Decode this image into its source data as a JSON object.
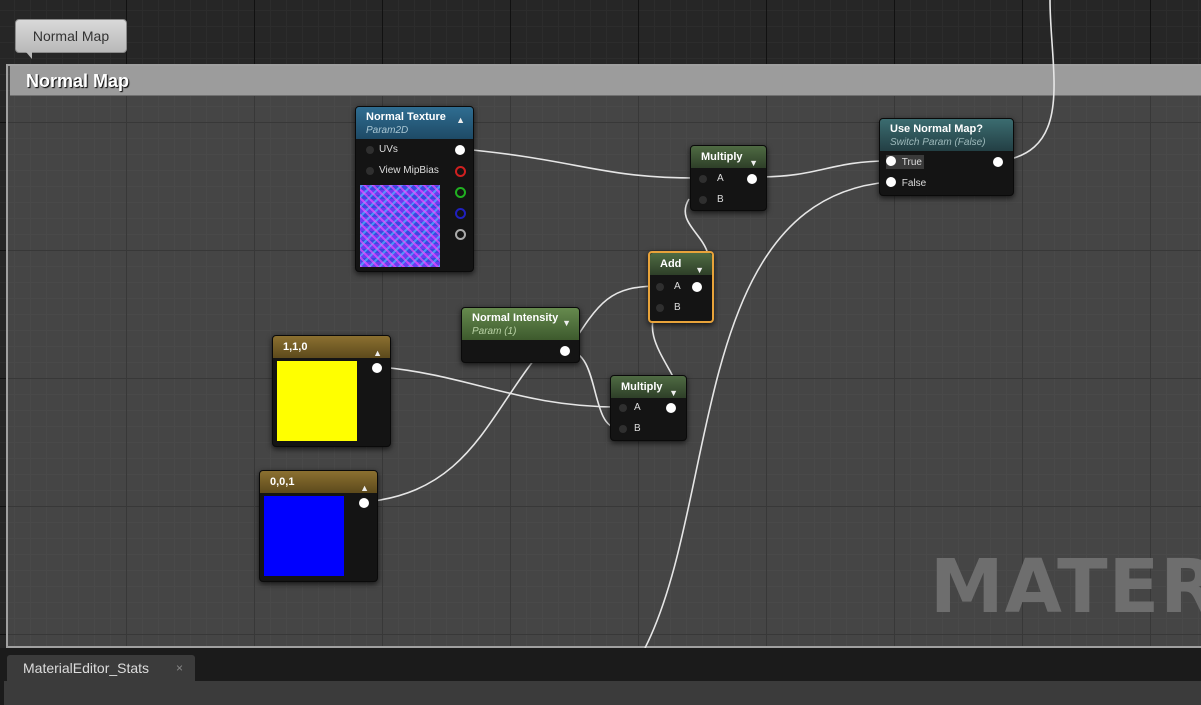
{
  "comment": {
    "bubble": "Normal Map",
    "title": "Normal Map"
  },
  "nodes": {
    "normal_texture": {
      "title": "Normal Texture",
      "sub": "Param2D",
      "pins": [
        "UVs",
        "View MipBias"
      ]
    },
    "multiply_top": {
      "title": "Multiply",
      "pins": [
        "A",
        "B"
      ]
    },
    "use_normal_map": {
      "title": "Use Normal Map?",
      "sub": "Switch Param (False)",
      "pins": [
        "True",
        "False"
      ]
    },
    "add": {
      "title": "Add",
      "pins": [
        "A",
        "B"
      ]
    },
    "normal_intensity": {
      "title": "Normal Intensity",
      "sub": "Param (1)"
    },
    "const_110": {
      "title": "1,1,0",
      "color": "#ffff00"
    },
    "multiply_bottom": {
      "title": "Multiply",
      "pins": [
        "A",
        "B"
      ]
    },
    "const_001": {
      "title": "0,0,1",
      "color": "#0000ff"
    }
  },
  "watermark": "MATERIA",
  "bottom_tab": {
    "label": "MaterialEditor_Stats",
    "close": "×"
  }
}
